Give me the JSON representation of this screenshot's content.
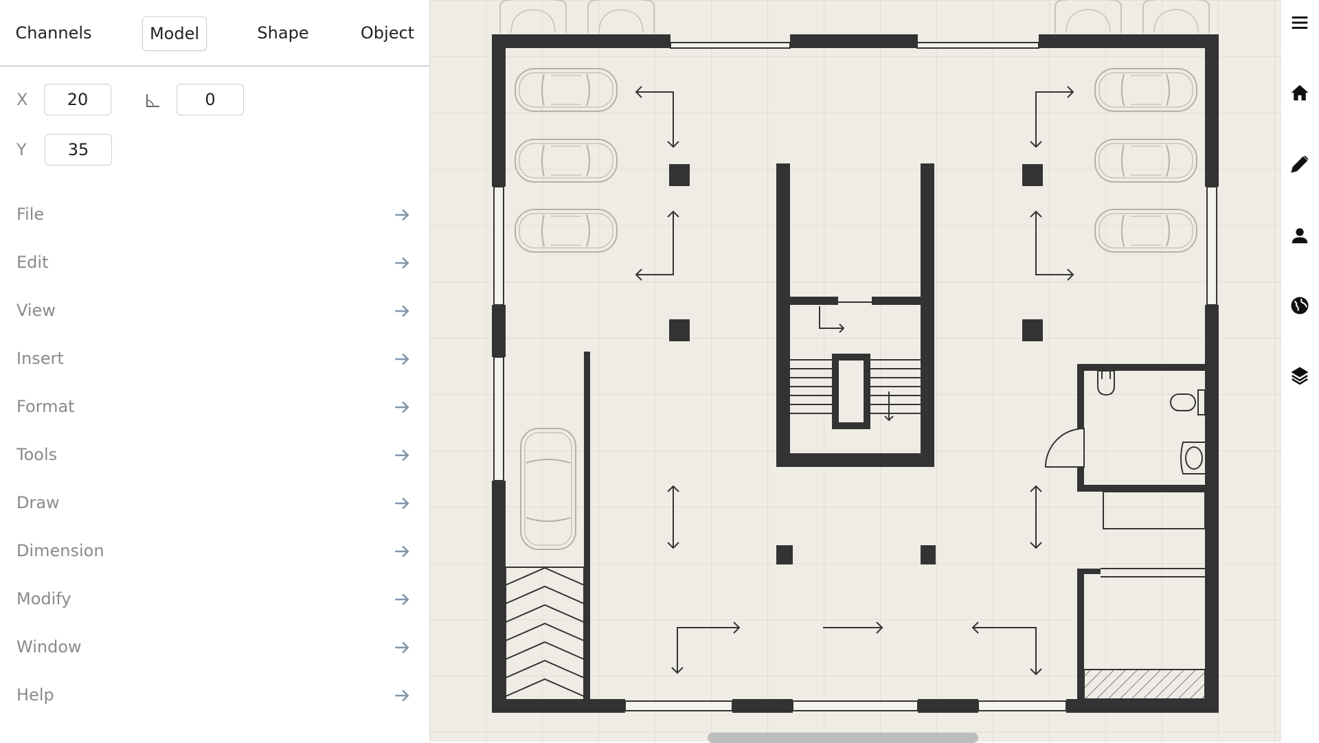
{
  "tabs": [
    {
      "label": "Channels",
      "active": false
    },
    {
      "label": "Model",
      "active": true
    },
    {
      "label": "Shape",
      "active": false
    },
    {
      "label": "Object",
      "active": false
    }
  ],
  "fields": {
    "x_label": "X",
    "x_value": "20",
    "angle_value": "0",
    "y_label": "Y",
    "y_value": "35"
  },
  "menu": [
    {
      "label": "File"
    },
    {
      "label": "Edit"
    },
    {
      "label": "View"
    },
    {
      "label": "Insert"
    },
    {
      "label": "Format"
    },
    {
      "label": "Tools"
    },
    {
      "label": "Draw"
    },
    {
      "label": "Dimension"
    },
    {
      "label": "Modify"
    },
    {
      "label": "Window"
    },
    {
      "label": "Help"
    }
  ],
  "icons": {
    "angle": "angle-icon",
    "menu_arrow": "arrow-right-icon",
    "toolbar": [
      "hamburger-menu-icon",
      "home-icon",
      "pencil-icon",
      "person-icon",
      "globe-icon",
      "layers-icon"
    ]
  },
  "colors": {
    "canvas_bg": "#efece5",
    "wall": "#333333",
    "text": "#222222",
    "muted": "#8a8a8a",
    "arrow": "#7f97ad"
  }
}
